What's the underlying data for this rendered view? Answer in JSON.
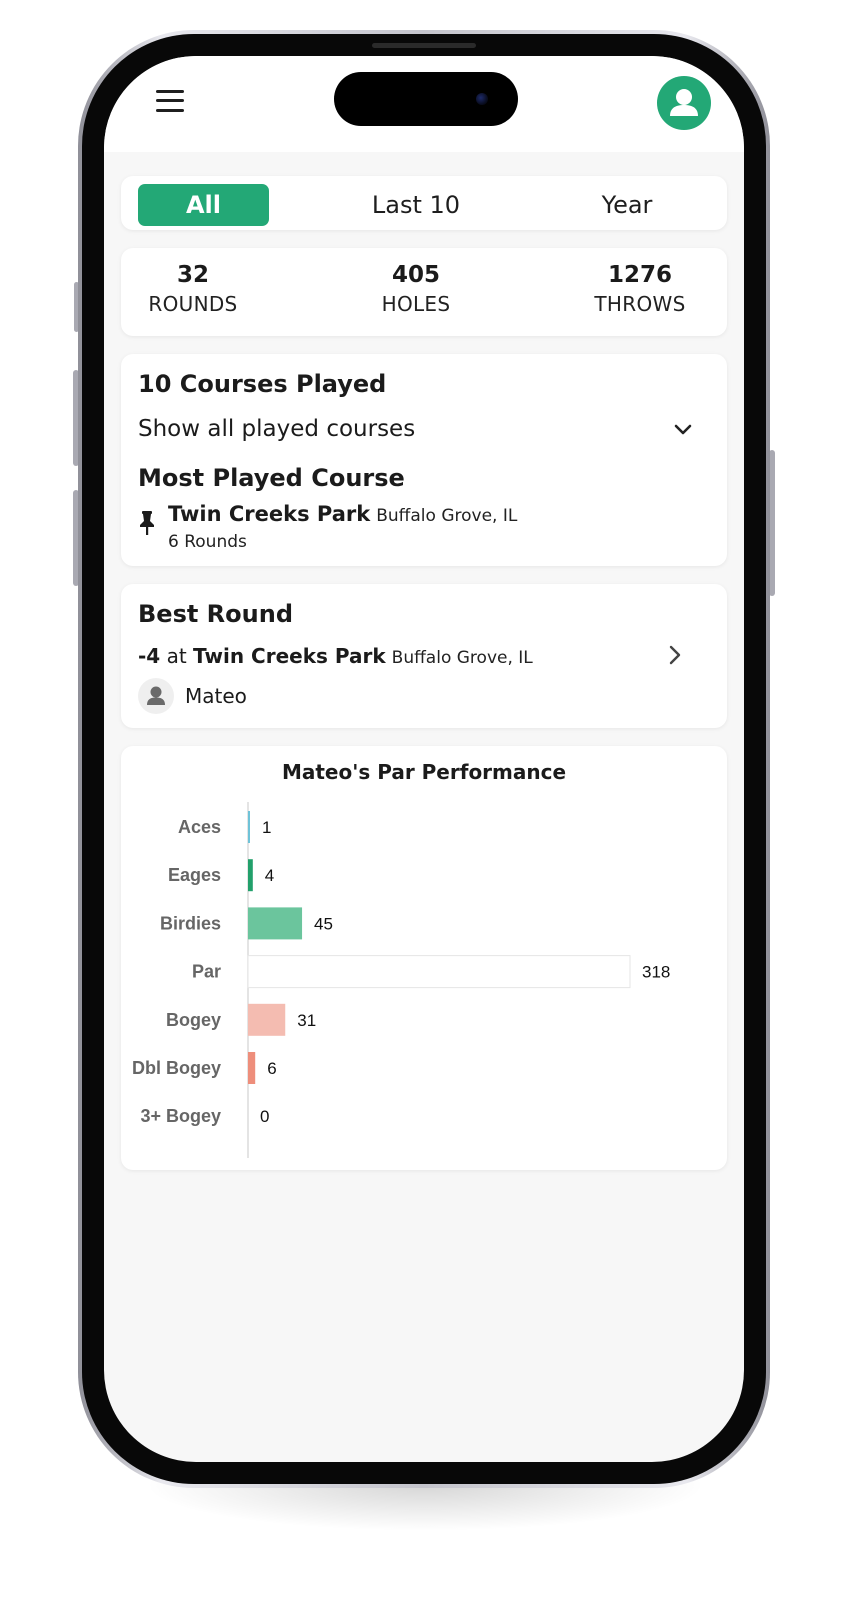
{
  "filters": {
    "tabs": [
      {
        "label": "All",
        "active": true
      },
      {
        "label": "Last 10",
        "active": false
      },
      {
        "label": "Year",
        "active": false
      }
    ]
  },
  "stats": [
    {
      "value": "32",
      "label": "ROUNDS"
    },
    {
      "value": "405",
      "label": "HOLES"
    },
    {
      "value": "1276",
      "label": "THROWS"
    }
  ],
  "courses": {
    "title": "10 Courses Played",
    "show_all": "Show all played courses",
    "most_played_heading": "Most Played Course",
    "most_played": {
      "name": "Twin Creeks Park",
      "location": "Buffalo Grove, IL",
      "rounds": "6 Rounds"
    }
  },
  "best_round": {
    "heading": "Best Round",
    "score": "-4",
    "connector": "at",
    "course": "Twin Creeks Park",
    "location": "Buffalo Grove, IL",
    "player": "Mateo"
  },
  "icons": {
    "menu": "hamburger-icon",
    "profile": "user-icon",
    "expand": "chevron-down-icon",
    "navigate": "chevron-right-icon",
    "course": "pin-icon",
    "player": "user-icon"
  },
  "colors": {
    "accent": "#23a876",
    "aces": "#6fc3d8",
    "eagles": "#22a06b",
    "birdies": "#6bc59d",
    "par": "#ffffff",
    "bogey": "#f4bcb1",
    "double_bogey": "#ee8e7b",
    "triple_bogey": "#e06b55"
  },
  "chart_data": {
    "type": "bar",
    "orientation": "horizontal",
    "title": "Mateo's Par Performance",
    "categories": [
      "Aces",
      "Eages",
      "Birdies",
      "Par",
      "Bogey",
      "Dbl Bogey",
      "3+ Bogey"
    ],
    "values": [
      1,
      4,
      45,
      318,
      31,
      6,
      0
    ],
    "xlim": [
      0,
      318
    ],
    "grid": false,
    "data_labels": true
  }
}
